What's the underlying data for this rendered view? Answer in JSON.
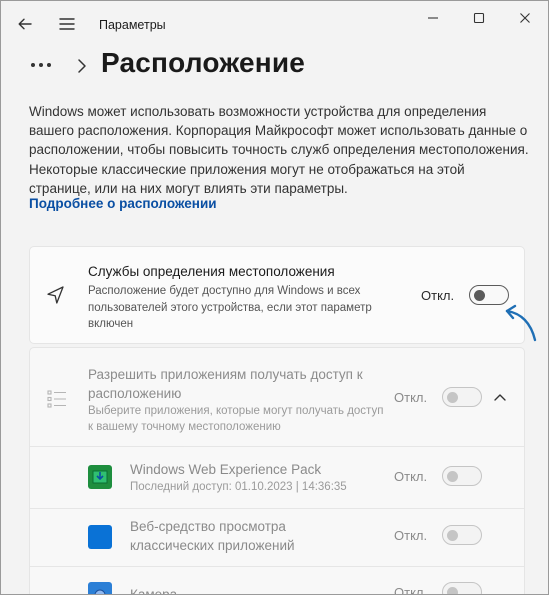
{
  "window": {
    "app_title": "Параметры"
  },
  "header": {
    "page_title": "Расположение"
  },
  "description": "Windows может использовать возможности устройства для определения вашего расположения. Корпорация Майкрософт может использовать данные о расположении, чтобы повысить точность служб определения местоположения. Некоторые классические приложения могут не отображаться на этой странице, или на них могут влиять эти параметры.",
  "learn_more": "Подробнее о расположении",
  "location_services": {
    "title": "Службы определения местоположения",
    "subtitle": "Расположение будет доступно для Windows и всех пользователей этого устройства, если этот параметр включен",
    "state": "Откл.",
    "on": false
  },
  "app_access": {
    "title": "Разрешить приложениям получать доступ к расположению",
    "subtitle": "Выберите приложения, которые могут получать доступ к вашему точному местоположению",
    "state": "Откл.",
    "on": false,
    "apps": [
      {
        "name": "Windows Web Experience Pack",
        "detail": "Последний доступ: 01.10.2023  |  14:36:35",
        "state": "Откл.",
        "on": false,
        "icon_color": "#1e8e3e"
      },
      {
        "name": "Веб-средство просмотра классических приложений",
        "detail": "",
        "state": "Откл.",
        "on": false,
        "icon_color": "#0a72d6"
      },
      {
        "name": "Камера",
        "detail": "",
        "state": "Откл.",
        "on": false,
        "icon_color": "#2b7fd6"
      }
    ]
  },
  "colors": {
    "accent": "#0a4fa3",
    "arrow": "#1f6fb5"
  }
}
